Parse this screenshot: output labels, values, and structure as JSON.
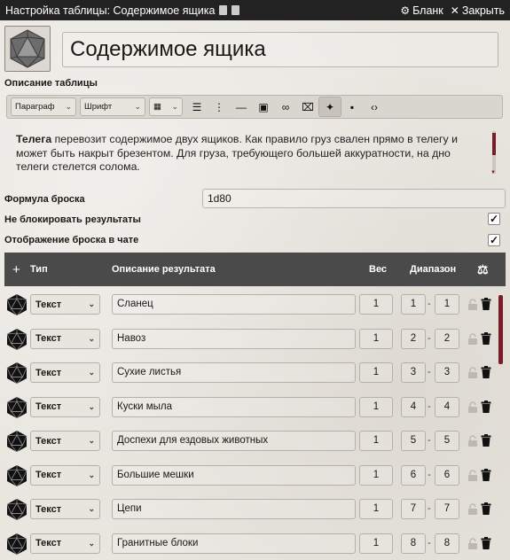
{
  "window": {
    "title": "Настройка таблицы: Содержимое ящика",
    "blank_label": "Бланк",
    "close_label": "Закрыть"
  },
  "table": {
    "name": "Содержимое ящика"
  },
  "description": {
    "label": "Описание таблицы",
    "paragraph_select": "Параграф",
    "font_select": "Шрифт",
    "text_bold": "Телега",
    "text_rest": " перевозит содержимое двух ящиков. Как правило груз свален прямо в телегу и может быть накрыт брезентом. Для груза, требующего большей аккуратности, на дно телеги стелется солома."
  },
  "formula": {
    "label": "Формула броска",
    "value": "1d80"
  },
  "options": {
    "no_lock_label": "Не блокировать результаты",
    "no_lock_checked": true,
    "chat_roll_label": "Отображение броска в чате",
    "chat_roll_checked": true
  },
  "results_header": {
    "add": "+",
    "type": "Тип",
    "description": "Описание результата",
    "weight": "Вес",
    "range": "Диапазон"
  },
  "results": [
    {
      "type": "Текст",
      "text": "Сланец",
      "weight": "1",
      "from": "1",
      "to": "1"
    },
    {
      "type": "Текст",
      "text": "Навоз",
      "weight": "1",
      "from": "2",
      "to": "2"
    },
    {
      "type": "Текст",
      "text": "Сухие листья",
      "weight": "1",
      "from": "3",
      "to": "3"
    },
    {
      "type": "Текст",
      "text": "Куски мыла",
      "weight": "1",
      "from": "4",
      "to": "4"
    },
    {
      "type": "Текст",
      "text": "Доспехи для ездовых животных",
      "weight": "1",
      "from": "5",
      "to": "5"
    },
    {
      "type": "Текст",
      "text": "Большие мешки",
      "weight": "1",
      "from": "6",
      "to": "6"
    },
    {
      "type": "Текст",
      "text": "Цепи",
      "weight": "1",
      "from": "7",
      "to": "7"
    },
    {
      "type": "Текст",
      "text": "Гранитные блоки",
      "weight": "1",
      "from": "8",
      "to": "8"
    }
  ],
  "icons": {
    "settings": "gear-icon",
    "close": "close-icon",
    "die": "d20-icon",
    "lock": "lock-icon",
    "trash": "trash-icon",
    "balance": "balance-scale-icon"
  },
  "colors": {
    "titlebar": "#222222",
    "header_bar": "#4a4a4a",
    "accent_scroll": "#7a1b2a"
  }
}
